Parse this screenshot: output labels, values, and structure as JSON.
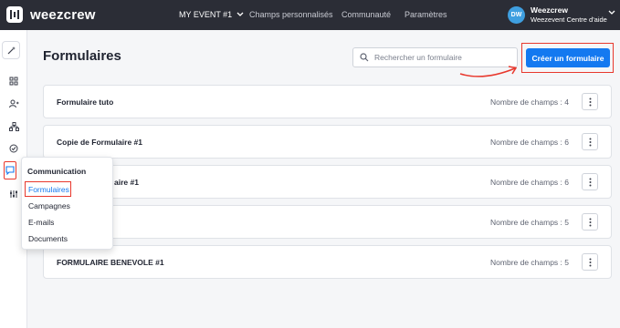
{
  "header": {
    "brand": "weezcrew",
    "event": "MY EVENT #1",
    "nav": [
      "Champs personnalisés",
      "Communauté",
      "Paramètres"
    ],
    "user": {
      "initials": "DW",
      "name": "Weezcrew",
      "subtitle": "Weezevent Centre d'aide"
    }
  },
  "main": {
    "title": "Formulaires",
    "search_placeholder": "Rechercher un formulaire",
    "create_label": "Créer un formulaire",
    "forms": [
      {
        "name": "Formulaire tuto",
        "count": "Nombre de champs : 4"
      },
      {
        "name": "Copie de Formulaire #1",
        "count": "Nombre de champs : 6"
      },
      {
        "name": "aire #1",
        "count": "Nombre de champs : 6"
      },
      {
        "name": "",
        "count": "Nombre de champs : 5"
      },
      {
        "name": "FORMULAIRE BENEVOLE #1",
        "count": "Nombre de champs : 5"
      }
    ]
  },
  "popover": {
    "title": "Communication",
    "items": [
      "Formulaires",
      "Campagnes",
      "E-mails",
      "Documents"
    ]
  },
  "colors": {
    "accent": "#1479f0",
    "highlight": "#e8382d",
    "topbar": "#2b2d36"
  }
}
